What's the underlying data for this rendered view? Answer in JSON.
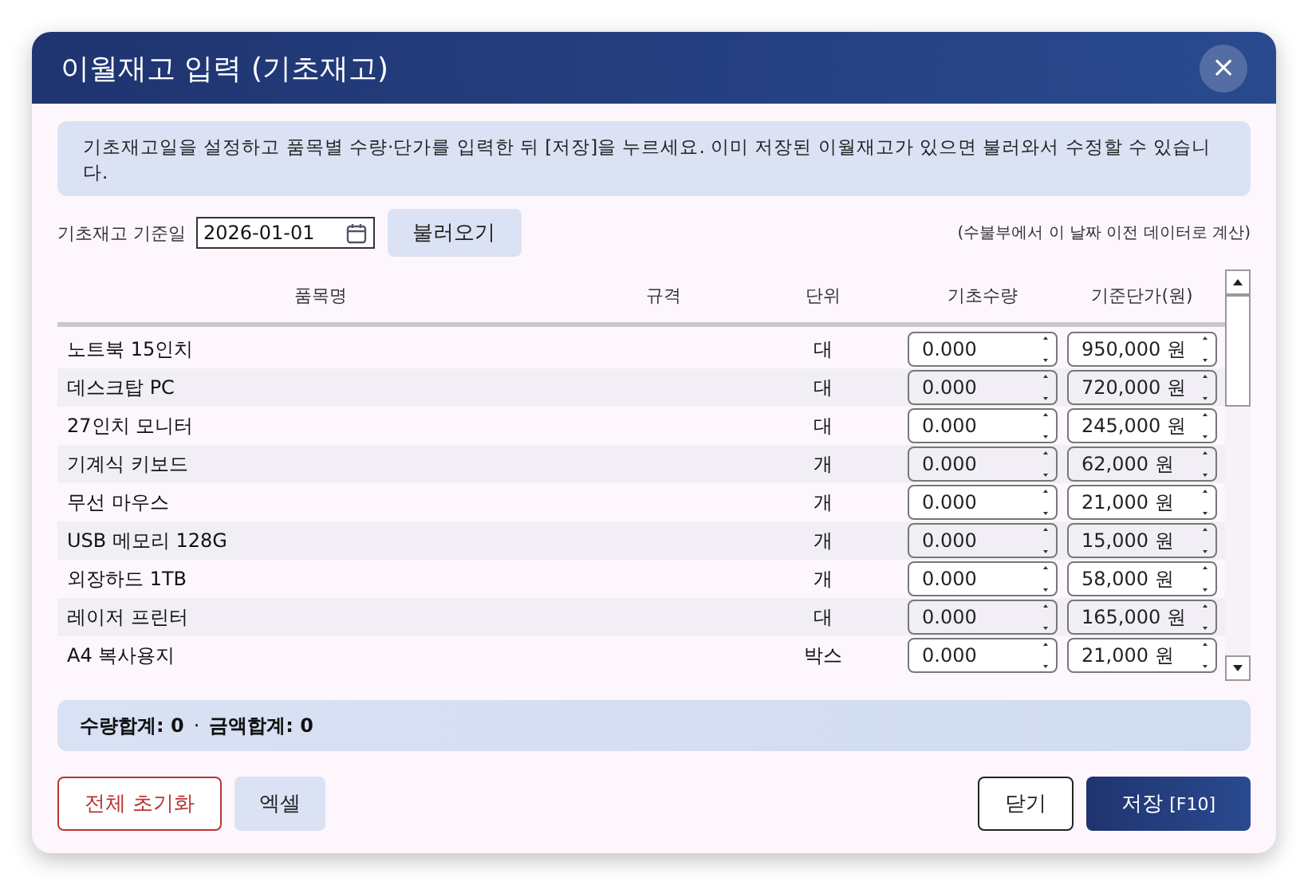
{
  "dialog": {
    "title": "이월재고 입력 (기초재고)",
    "close": "×"
  },
  "info": "기초재고일을 설정하고 품목별 수량·단가를 입력한 뒤 [저장]을 누르세요. 이미 저장된 이월재고가 있으면 불러와서 수정할 수 있습니다.",
  "date_row": {
    "label": "기초재고 기준일",
    "date": "2026-01-01",
    "load_button": "불러오기",
    "note": "(수불부에서 이 날짜 이전 데이터로 계산)"
  },
  "table": {
    "columns": [
      "품목명",
      "규격",
      "단위",
      "기초수량",
      "기준단가(원)"
    ],
    "rows": [
      {
        "name": "노트북 15인치",
        "unit": "대",
        "qty": "0.000",
        "price": "950,000 원"
      },
      {
        "name": "데스크탑 PC",
        "unit": "대",
        "qty": "0.000",
        "price": "720,000 원"
      },
      {
        "name": "27인치 모니터",
        "unit": "대",
        "qty": "0.000",
        "price": "245,000 원"
      },
      {
        "name": "기계식 키보드",
        "unit": "개",
        "qty": "0.000",
        "price": "62,000 원"
      },
      {
        "name": "무선 마우스",
        "unit": "개",
        "qty": "0.000",
        "price": "21,000 원"
      },
      {
        "name": "USB 메모리 128G",
        "unit": "개",
        "qty": "0.000",
        "price": "15,000 원"
      },
      {
        "name": "외장하드 1TB",
        "unit": "개",
        "qty": "0.000",
        "price": "58,000 원"
      },
      {
        "name": "레이저 프린터",
        "unit": "대",
        "qty": "0.000",
        "price": "165,000 원"
      },
      {
        "name": "A4 복사용지",
        "unit": "박스",
        "qty": "0.000",
        "price": "21,000 원"
      }
    ]
  },
  "summary": {
    "qty_label": "수량합계: 0",
    "separator": "·",
    "amount_label": "금액합계: 0"
  },
  "buttons": [
    {
      "label": "전체 초기화",
      "kind": "danger"
    },
    {
      "label": "엑셀",
      "kind": "soft"
    },
    {
      "label": "닫기",
      "kind": "outline"
    },
    {
      "label": "저장",
      "shortcut": "[F10]",
      "kind": "primary"
    }
  ]
}
